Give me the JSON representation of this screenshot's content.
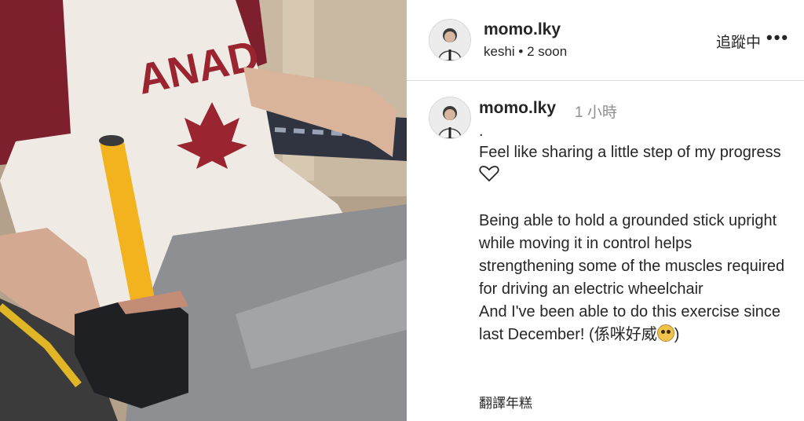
{
  "post": {
    "username": "momo.lky",
    "subtitle_name": "keshi",
    "subtitle_sep": "•",
    "subtitle_time": "2 soon",
    "follow_label": "追蹤中",
    "more_label": "•••"
  },
  "comment": {
    "username": "momo.lky",
    "time": "1 小時",
    "dot": ".",
    "line1": "Feel like sharing a little step of my progress",
    "line2": "Being able to hold a grounded stick upright while moving it in control helps strengthening some of the muscles required for driving an electric wheelchair",
    "line3a": "And I've been able to do this exercise since last December! (係咪好威",
    "line3b": ")",
    "translate_label": "翻譯年糕"
  },
  "icons": {
    "heart": "heart-outline-icon",
    "emoji": "owl-face-emoji"
  },
  "colors": {
    "text": "#262626",
    "muted": "#8e8e8e",
    "divider": "#dbdbdb",
    "shirt_red": "#8b2332",
    "stick_yellow": "#f2b31e"
  }
}
